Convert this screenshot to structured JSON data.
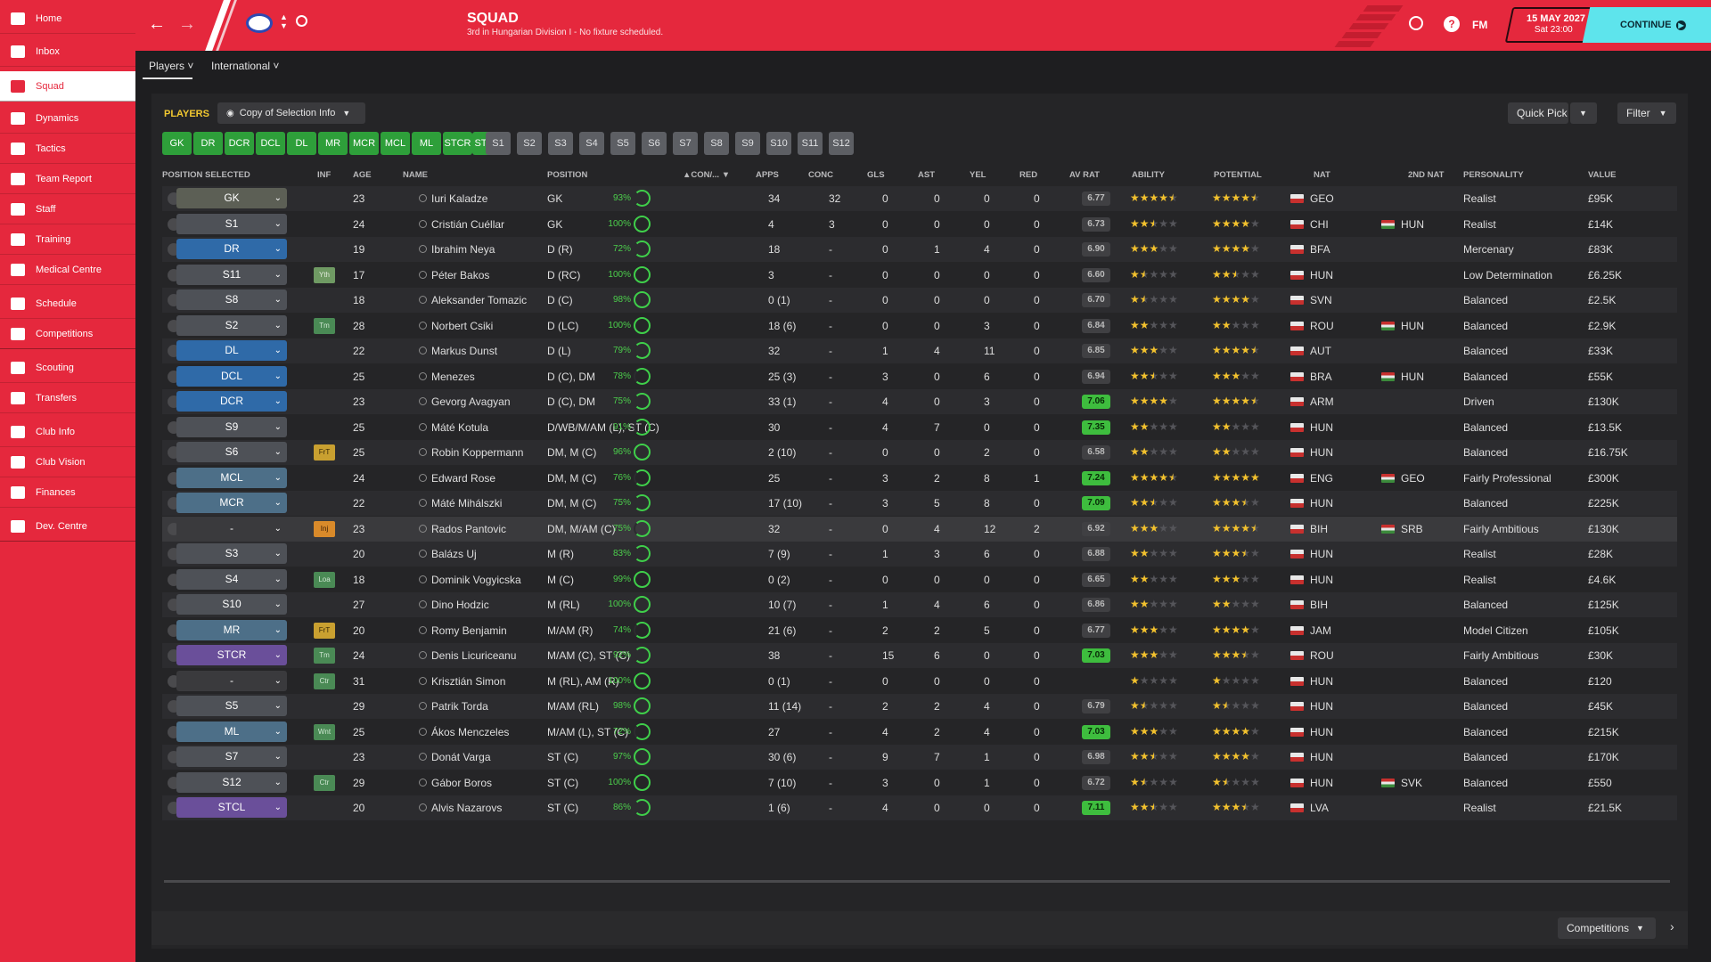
{
  "sidebar": {
    "items": [
      {
        "label": "Home",
        "icon": "home-icon"
      },
      {
        "label": "Inbox",
        "icon": "inbox-icon"
      },
      {
        "label": "Squad",
        "icon": "squad-icon",
        "active": true
      },
      {
        "label": "Dynamics",
        "icon": "dynamics-icon"
      },
      {
        "label": "Tactics",
        "icon": "tactics-icon"
      },
      {
        "label": "Team Report",
        "icon": "report-icon"
      },
      {
        "label": "Staff",
        "icon": "staff-icon"
      },
      {
        "label": "Training",
        "icon": "training-icon"
      },
      {
        "label": "Medical Centre",
        "icon": "medical-icon"
      },
      {
        "label": "Schedule",
        "icon": "schedule-icon"
      },
      {
        "label": "Competitions",
        "icon": "trophy-icon"
      },
      {
        "label": "Scouting",
        "icon": "scouting-icon"
      },
      {
        "label": "Transfers",
        "icon": "transfers-icon"
      },
      {
        "label": "Club Info",
        "icon": "club-info-icon"
      },
      {
        "label": "Club Vision",
        "icon": "club-vision-icon"
      },
      {
        "label": "Finances",
        "icon": "finances-icon"
      },
      {
        "label": "Dev. Centre",
        "icon": "dev-centre-icon"
      }
    ]
  },
  "header": {
    "title": "SQUAD",
    "subtitle": "3rd in Hungarian Division I - No fixture scheduled.",
    "date": "15 MAY 2027",
    "time": "Sat 23:00",
    "continue_label": "CONTINUE",
    "fm_label": "FM",
    "help_label": "?"
  },
  "subtabs": {
    "players": "Players",
    "international": "International"
  },
  "panel": {
    "section_label": "PLAYERS",
    "view_label": "Copy of Selection Info",
    "quick_pick": "Quick Pick",
    "filter": "Filter",
    "footer_select": "Competitions"
  },
  "position_buttons": {
    "filled": [
      "GK",
      "DR",
      "DCR",
      "DCL",
      "DL",
      "MR",
      "MCR",
      "MCL",
      "ML",
      "STCR",
      "STCL"
    ],
    "subs": [
      "S1",
      "S2",
      "S3",
      "S4",
      "S5",
      "S6",
      "S7",
      "S8",
      "S9",
      "S10",
      "S11",
      "S12"
    ]
  },
  "columns": {
    "pos": "POSITION SELECTED",
    "inf": "INF",
    "age": "AGE",
    "name": "NAME",
    "position": "POSITION",
    "con": "CON/...",
    "apps": "APPS",
    "conc": "CONC",
    "gls": "GLS",
    "ast": "AST",
    "yel": "YEL",
    "red": "RED",
    "avrat": "AV RAT",
    "ability": "ABILITY",
    "potential": "POTENTIAL",
    "nat": "NAT",
    "nat2": "2ND NAT",
    "personality": "PERSONALITY",
    "value": "VALUE"
  },
  "colors": {
    "brand": "#e5283d",
    "accent": "#5ee4ec",
    "filled_pos": "#2e9f3a"
  },
  "players": [
    {
      "sel": "GK",
      "inf": "",
      "age": "23",
      "name": "Iuri Kaladze",
      "position": "GK",
      "con": "93%",
      "apps": "34",
      "conc": "32",
      "gls": "0",
      "ast": "0",
      "yel": "0",
      "red": "0",
      "avrat": "6.77",
      "ability": 4.5,
      "potential": 4.5,
      "nat": "GEO",
      "nat2": "",
      "personality": "Realist",
      "value": "£95K"
    },
    {
      "sel": "S1",
      "inf": "",
      "age": "24",
      "name": "Cristián Cuéllar",
      "position": "GK",
      "con": "100%",
      "apps": "4",
      "conc": "3",
      "gls": "0",
      "ast": "0",
      "yel": "0",
      "red": "0",
      "avrat": "6.73",
      "ability": 2.5,
      "potential": 4,
      "nat": "CHI",
      "nat2": "HUN",
      "personality": "Realist",
      "value": "£14K"
    },
    {
      "sel": "DR",
      "inf": "",
      "age": "19",
      "name": "Ibrahim Neya",
      "position": "D (R)",
      "con": "72%",
      "apps": "18",
      "conc": "-",
      "gls": "0",
      "ast": "1",
      "yel": "4",
      "red": "0",
      "avrat": "6.90",
      "ability": 3,
      "potential": 4,
      "nat": "BFA",
      "nat2": "",
      "personality": "Mercenary",
      "value": "£83K"
    },
    {
      "sel": "S11",
      "inf": "Yth",
      "age": "17",
      "name": "Péter Bakos",
      "position": "D (RC)",
      "con": "100%",
      "apps": "3",
      "conc": "-",
      "gls": "0",
      "ast": "0",
      "yel": "0",
      "red": "0",
      "avrat": "6.60",
      "ability": 1.5,
      "potential": 2.5,
      "nat": "HUN",
      "nat2": "",
      "personality": "Low Determination",
      "value": "£6.25K"
    },
    {
      "sel": "S8",
      "inf": "",
      "age": "18",
      "name": "Aleksander Tomazic",
      "position": "D (C)",
      "con": "98%",
      "apps": "0 (1)",
      "conc": "-",
      "gls": "0",
      "ast": "0",
      "yel": "0",
      "red": "0",
      "avrat": "6.70",
      "ability": 1.5,
      "potential": 4,
      "nat": "SVN",
      "nat2": "",
      "personality": "Balanced",
      "value": "£2.5K"
    },
    {
      "sel": "S2",
      "inf": "Tm",
      "age": "28",
      "name": "Norbert Csiki",
      "position": "D (LC)",
      "con": "100%",
      "apps": "18 (6)",
      "conc": "-",
      "gls": "0",
      "ast": "0",
      "yel": "3",
      "red": "0",
      "avrat": "6.84",
      "ability": 2,
      "potential": 2,
      "nat": "ROU",
      "nat2": "HUN",
      "personality": "Balanced",
      "value": "£2.9K"
    },
    {
      "sel": "DL",
      "inf": "",
      "age": "22",
      "name": "Markus Dunst",
      "position": "D (L)",
      "con": "79%",
      "apps": "32",
      "conc": "-",
      "gls": "1",
      "ast": "4",
      "yel": "11",
      "red": "0",
      "avrat": "6.85",
      "ability": 3,
      "potential": 4.5,
      "nat": "AUT",
      "nat2": "",
      "personality": "Balanced",
      "value": "£33K"
    },
    {
      "sel": "DCL",
      "inf": "",
      "age": "25",
      "name": "Menezes",
      "position": "D (C), DM",
      "con": "78%",
      "apps": "25 (3)",
      "conc": "-",
      "gls": "3",
      "ast": "0",
      "yel": "6",
      "red": "0",
      "avrat": "6.94",
      "ability": 2.5,
      "potential": 3,
      "nat": "BRA",
      "nat2": "HUN",
      "personality": "Balanced",
      "value": "£55K"
    },
    {
      "sel": "DCR",
      "inf": "",
      "age": "23",
      "name": "Gevorg Avagyan",
      "position": "D (C), DM",
      "con": "75%",
      "apps": "33 (1)",
      "conc": "-",
      "gls": "4",
      "ast": "0",
      "yel": "3",
      "red": "0",
      "avrat": "7.06",
      "ability": 4,
      "potential": 4.5,
      "nat": "ARM",
      "nat2": "",
      "personality": "Driven",
      "value": "£130K"
    },
    {
      "sel": "S9",
      "inf": "",
      "age": "25",
      "name": "Máté Kotula",
      "position": "D/WB/M/AM (L), ST (C)",
      "con": "91%",
      "apps": "30",
      "conc": "-",
      "gls": "4",
      "ast": "7",
      "yel": "0",
      "red": "0",
      "avrat": "7.35",
      "ability": 2,
      "potential": 2,
      "nat": "HUN",
      "nat2": "",
      "personality": "Balanced",
      "value": "£13.5K"
    },
    {
      "sel": "S6",
      "inf": "FrT",
      "age": "25",
      "name": "Robin Koppermann",
      "position": "DM, M (C)",
      "con": "96%",
      "apps": "2 (10)",
      "conc": "-",
      "gls": "0",
      "ast": "0",
      "yel": "2",
      "red": "0",
      "avrat": "6.58",
      "ability": 2,
      "potential": 2,
      "nat": "HUN",
      "nat2": "",
      "personality": "Balanced",
      "value": "£16.75K"
    },
    {
      "sel": "MCL",
      "inf": "",
      "age": "24",
      "name": "Edward Rose",
      "position": "DM, M (C)",
      "con": "76%",
      "apps": "25",
      "conc": "-",
      "gls": "3",
      "ast": "2",
      "yel": "8",
      "red": "1",
      "avrat": "7.24",
      "ability": 4.5,
      "potential": 5,
      "nat": "ENG",
      "nat2": "GEO",
      "personality": "Fairly Professional",
      "value": "£300K"
    },
    {
      "sel": "MCR",
      "inf": "",
      "age": "22",
      "name": "Máté Mihálszki",
      "position": "DM, M (C)",
      "con": "75%",
      "apps": "17 (10)",
      "conc": "-",
      "gls": "3",
      "ast": "5",
      "yel": "8",
      "red": "0",
      "avrat": "7.09",
      "ability": 2.5,
      "potential": 3.5,
      "nat": "HUN",
      "nat2": "",
      "personality": "Balanced",
      "value": "£225K"
    },
    {
      "sel": "-",
      "inf": "Inj",
      "age": "23",
      "name": "Rados Pantovic",
      "position": "DM, M/AM (C)",
      "con": "75%",
      "apps": "32",
      "conc": "-",
      "gls": "0",
      "ast": "4",
      "yel": "12",
      "red": "2",
      "avrat": "6.92",
      "ability": 3,
      "potential": 4.5,
      "nat": "BIH",
      "nat2": "SRB",
      "personality": "Fairly Ambitious",
      "value": "£130K"
    },
    {
      "sel": "S3",
      "inf": "",
      "age": "20",
      "name": "Balázs Uj",
      "position": "M (R)",
      "con": "83%",
      "apps": "7 (9)",
      "conc": "-",
      "gls": "1",
      "ast": "3",
      "yel": "6",
      "red": "0",
      "avrat": "6.88",
      "ability": 2,
      "potential": 3.5,
      "nat": "HUN",
      "nat2": "",
      "personality": "Realist",
      "value": "£28K"
    },
    {
      "sel": "S4",
      "inf": "Loa",
      "age": "18",
      "name": "Dominik Vogyicska",
      "position": "M (C)",
      "con": "99%",
      "apps": "0 (2)",
      "conc": "-",
      "gls": "0",
      "ast": "0",
      "yel": "0",
      "red": "0",
      "avrat": "6.65",
      "ability": 2,
      "potential": 3,
      "nat": "HUN",
      "nat2": "",
      "personality": "Realist",
      "value": "£4.6K"
    },
    {
      "sel": "S10",
      "inf": "",
      "age": "27",
      "name": "Dino Hodzic",
      "position": "M (RL)",
      "con": "100%",
      "apps": "10 (7)",
      "conc": "-",
      "gls": "1",
      "ast": "4",
      "yel": "6",
      "red": "0",
      "avrat": "6.86",
      "ability": 2,
      "potential": 2,
      "nat": "BIH",
      "nat2": "",
      "personality": "Balanced",
      "value": "£125K"
    },
    {
      "sel": "MR",
      "inf": "FrT",
      "age": "20",
      "name": "Romy Benjamin",
      "position": "M/AM (R)",
      "con": "74%",
      "apps": "21 (6)",
      "conc": "-",
      "gls": "2",
      "ast": "2",
      "yel": "5",
      "red": "0",
      "avrat": "6.77",
      "ability": 3,
      "potential": 4,
      "nat": "JAM",
      "nat2": "",
      "personality": "Model Citizen",
      "value": "£105K"
    },
    {
      "sel": "STCR",
      "inf": "Tm",
      "age": "24",
      "name": "Denis Licuriceanu",
      "position": "M/AM (C), ST (C)",
      "con": "92%",
      "apps": "38",
      "conc": "-",
      "gls": "15",
      "ast": "6",
      "yel": "0",
      "red": "0",
      "avrat": "7.03",
      "ability": 3,
      "potential": 3.5,
      "nat": "ROU",
      "nat2": "",
      "personality": "Fairly Ambitious",
      "value": "£30K"
    },
    {
      "sel": "-",
      "inf": "Ctr",
      "age": "31",
      "name": "Krisztián Simon",
      "position": "M (RL), AM (R)",
      "con": "100%",
      "apps": "0 (1)",
      "conc": "-",
      "gls": "0",
      "ast": "0",
      "yel": "0",
      "red": "0",
      "avrat": "",
      "ability": 1,
      "potential": 1,
      "nat": "HUN",
      "nat2": "",
      "personality": "Balanced",
      "value": "£120"
    },
    {
      "sel": "S5",
      "inf": "",
      "age": "29",
      "name": "Patrik Torda",
      "position": "M/AM (RL)",
      "con": "98%",
      "apps": "11 (14)",
      "conc": "-",
      "gls": "2",
      "ast": "2",
      "yel": "4",
      "red": "0",
      "avrat": "6.79",
      "ability": 1.5,
      "potential": 1.5,
      "nat": "HUN",
      "nat2": "",
      "personality": "Balanced",
      "value": "£45K"
    },
    {
      "sel": "ML",
      "inf": "Wnt",
      "age": "25",
      "name": "Ákos Menczeles",
      "position": "M/AM (L), ST (C)",
      "con": "72%",
      "apps": "27",
      "conc": "-",
      "gls": "4",
      "ast": "2",
      "yel": "4",
      "red": "0",
      "avrat": "7.03",
      "ability": 3,
      "potential": 4,
      "nat": "HUN",
      "nat2": "",
      "personality": "Balanced",
      "value": "£215K"
    },
    {
      "sel": "S7",
      "inf": "",
      "age": "23",
      "name": "Donát Varga",
      "position": "ST (C)",
      "con": "97%",
      "apps": "30 (6)",
      "conc": "-",
      "gls": "9",
      "ast": "7",
      "yel": "1",
      "red": "0",
      "avrat": "6.98",
      "ability": 2.5,
      "potential": 4,
      "nat": "HUN",
      "nat2": "",
      "personality": "Balanced",
      "value": "£170K"
    },
    {
      "sel": "S12",
      "inf": "Ctr",
      "age": "29",
      "name": "Gábor Boros",
      "position": "ST (C)",
      "con": "100%",
      "apps": "7 (10)",
      "conc": "-",
      "gls": "3",
      "ast": "0",
      "yel": "1",
      "red": "0",
      "avrat": "6.72",
      "ability": 1.5,
      "potential": 1.5,
      "nat": "HUN",
      "nat2": "SVK",
      "personality": "Balanced",
      "value": "£550"
    },
    {
      "sel": "STCL",
      "inf": "",
      "age": "20",
      "name": "Alvis Nazarovs",
      "position": "ST (C)",
      "con": "86%",
      "apps": "1 (6)",
      "conc": "-",
      "gls": "4",
      "ast": "0",
      "yel": "0",
      "red": "0",
      "avrat": "7.11",
      "ability": 2.5,
      "potential": 3.5,
      "nat": "LVA",
      "nat2": "",
      "personality": "Realist",
      "value": "£21.5K"
    }
  ]
}
